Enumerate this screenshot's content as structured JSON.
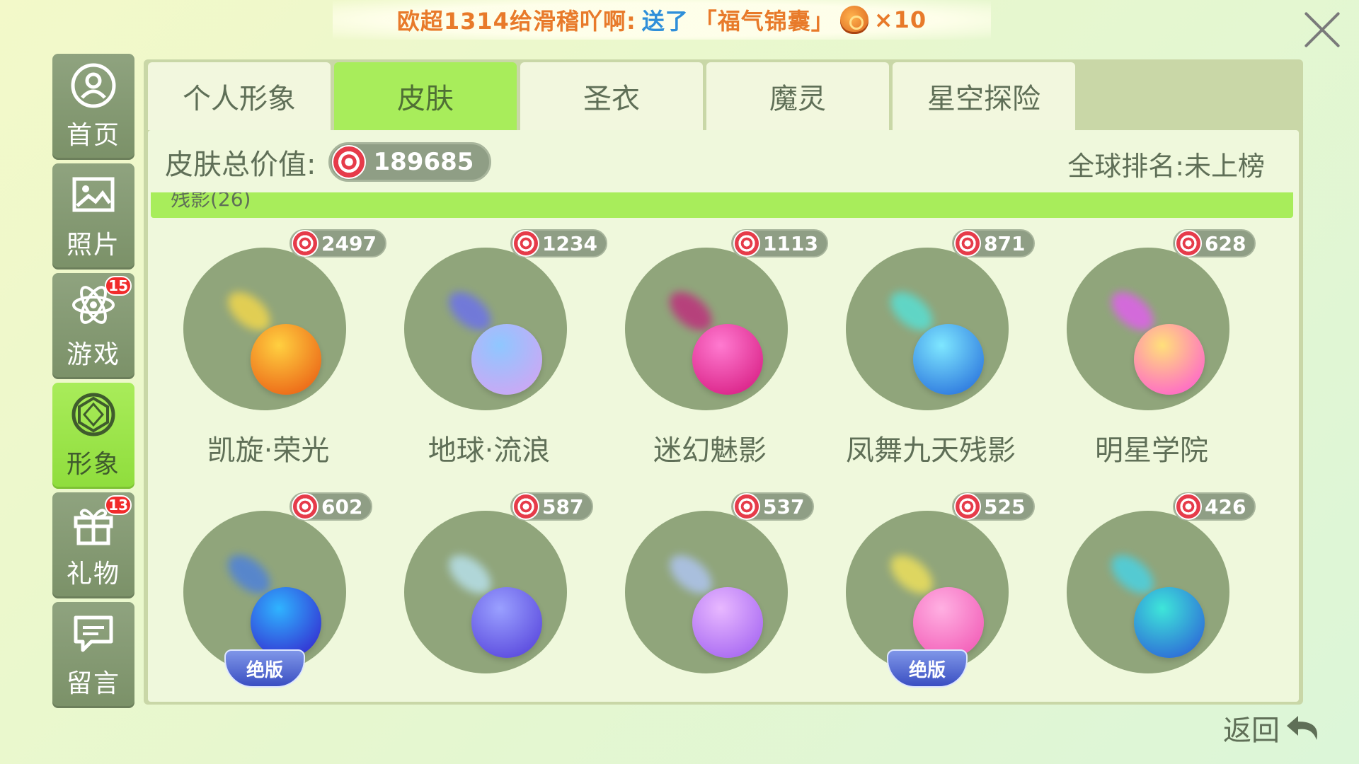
{
  "banner": {
    "sender": "欧超1314给滑稽吖啊:",
    "message": "送了",
    "gift": "「福气锦囊」",
    "multiplier": "×10"
  },
  "sidebar": {
    "items": [
      {
        "label": "首页",
        "icon": "user-icon"
      },
      {
        "label": "照片",
        "icon": "photo-icon"
      },
      {
        "label": "游戏",
        "icon": "atom-icon",
        "badge": "15"
      },
      {
        "label": "形象",
        "icon": "gem-icon"
      },
      {
        "label": "礼物",
        "icon": "gift-icon",
        "badge": "13"
      },
      {
        "label": "留言",
        "icon": "message-icon"
      }
    ],
    "active_index": 3
  },
  "tabs": [
    "个人形象",
    "皮肤",
    "圣衣",
    "魔灵",
    "星空探险"
  ],
  "active_tab": "皮肤",
  "summary": {
    "value_label": "皮肤总价值:",
    "value": "189685",
    "rank": "全球排名:未上榜"
  },
  "section_partial": "残影(26)",
  "skins": [
    {
      "price": "2497",
      "name": "凯旋·荣光",
      "color_top": "#ffd040",
      "color_bottom": "#e8520f",
      "trail": "#f6d94a"
    },
    {
      "price": "1234",
      "name": "地球·流浪",
      "color_top": "#8fc7ff",
      "color_bottom": "#d9a1f2",
      "trail": "#6a6ff0"
    },
    {
      "price": "1113",
      "name": "迷幻魅影",
      "color_top": "#ff7ad0",
      "color_bottom": "#d3127a",
      "trail": "#c0297c"
    },
    {
      "price": "871",
      "name": "凤舞九天残影",
      "color_top": "#7ee7ff",
      "color_bottom": "#1e63d8",
      "trail": "#55e2d8"
    },
    {
      "price": "628",
      "name": "明星学院",
      "color_top": "#ffe07a",
      "color_bottom": "#ff4fd9",
      "trail": "#e45cf2"
    },
    {
      "price": "602",
      "name": "",
      "color_top": "#2fb4ff",
      "color_bottom": "#3516c9",
      "trail": "#4a7fe0",
      "tag": "绝版"
    },
    {
      "price": "587",
      "name": "",
      "color_top": "#9aa0ff",
      "color_bottom": "#4f3ad8",
      "trail": "#b9e3f0"
    },
    {
      "price": "537",
      "name": "",
      "color_top": "#e8b8ff",
      "color_bottom": "#9c5af0",
      "trail": "#b0c6f6"
    },
    {
      "price": "525",
      "name": "",
      "color_top": "#ffb0e2",
      "color_bottom": "#f04fb0",
      "trail": "#f2e35a",
      "tag": "绝版"
    },
    {
      "price": "426",
      "name": "",
      "color_top": "#3ee6d9",
      "color_bottom": "#2a52d8",
      "trail": "#46d4e8"
    }
  ],
  "back_label": "返回"
}
